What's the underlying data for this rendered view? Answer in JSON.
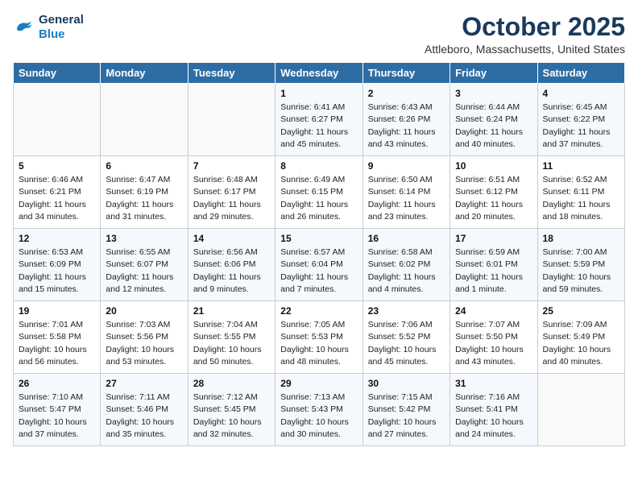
{
  "header": {
    "logo_line1": "General",
    "logo_line2": "Blue",
    "month": "October 2025",
    "location": "Attleboro, Massachusetts, United States"
  },
  "weekdays": [
    "Sunday",
    "Monday",
    "Tuesday",
    "Wednesday",
    "Thursday",
    "Friday",
    "Saturday"
  ],
  "weeks": [
    [
      {
        "day": "",
        "info": ""
      },
      {
        "day": "",
        "info": ""
      },
      {
        "day": "",
        "info": ""
      },
      {
        "day": "1",
        "info": "Sunrise: 6:41 AM\nSunset: 6:27 PM\nDaylight: 11 hours\nand 45 minutes."
      },
      {
        "day": "2",
        "info": "Sunrise: 6:43 AM\nSunset: 6:26 PM\nDaylight: 11 hours\nand 43 minutes."
      },
      {
        "day": "3",
        "info": "Sunrise: 6:44 AM\nSunset: 6:24 PM\nDaylight: 11 hours\nand 40 minutes."
      },
      {
        "day": "4",
        "info": "Sunrise: 6:45 AM\nSunset: 6:22 PM\nDaylight: 11 hours\nand 37 minutes."
      }
    ],
    [
      {
        "day": "5",
        "info": "Sunrise: 6:46 AM\nSunset: 6:21 PM\nDaylight: 11 hours\nand 34 minutes."
      },
      {
        "day": "6",
        "info": "Sunrise: 6:47 AM\nSunset: 6:19 PM\nDaylight: 11 hours\nand 31 minutes."
      },
      {
        "day": "7",
        "info": "Sunrise: 6:48 AM\nSunset: 6:17 PM\nDaylight: 11 hours\nand 29 minutes."
      },
      {
        "day": "8",
        "info": "Sunrise: 6:49 AM\nSunset: 6:15 PM\nDaylight: 11 hours\nand 26 minutes."
      },
      {
        "day": "9",
        "info": "Sunrise: 6:50 AM\nSunset: 6:14 PM\nDaylight: 11 hours\nand 23 minutes."
      },
      {
        "day": "10",
        "info": "Sunrise: 6:51 AM\nSunset: 6:12 PM\nDaylight: 11 hours\nand 20 minutes."
      },
      {
        "day": "11",
        "info": "Sunrise: 6:52 AM\nSunset: 6:11 PM\nDaylight: 11 hours\nand 18 minutes."
      }
    ],
    [
      {
        "day": "12",
        "info": "Sunrise: 6:53 AM\nSunset: 6:09 PM\nDaylight: 11 hours\nand 15 minutes."
      },
      {
        "day": "13",
        "info": "Sunrise: 6:55 AM\nSunset: 6:07 PM\nDaylight: 11 hours\nand 12 minutes."
      },
      {
        "day": "14",
        "info": "Sunrise: 6:56 AM\nSunset: 6:06 PM\nDaylight: 11 hours\nand 9 minutes."
      },
      {
        "day": "15",
        "info": "Sunrise: 6:57 AM\nSunset: 6:04 PM\nDaylight: 11 hours\nand 7 minutes."
      },
      {
        "day": "16",
        "info": "Sunrise: 6:58 AM\nSunset: 6:02 PM\nDaylight: 11 hours\nand 4 minutes."
      },
      {
        "day": "17",
        "info": "Sunrise: 6:59 AM\nSunset: 6:01 PM\nDaylight: 11 hours\nand 1 minute."
      },
      {
        "day": "18",
        "info": "Sunrise: 7:00 AM\nSunset: 5:59 PM\nDaylight: 10 hours\nand 59 minutes."
      }
    ],
    [
      {
        "day": "19",
        "info": "Sunrise: 7:01 AM\nSunset: 5:58 PM\nDaylight: 10 hours\nand 56 minutes."
      },
      {
        "day": "20",
        "info": "Sunrise: 7:03 AM\nSunset: 5:56 PM\nDaylight: 10 hours\nand 53 minutes."
      },
      {
        "day": "21",
        "info": "Sunrise: 7:04 AM\nSunset: 5:55 PM\nDaylight: 10 hours\nand 50 minutes."
      },
      {
        "day": "22",
        "info": "Sunrise: 7:05 AM\nSunset: 5:53 PM\nDaylight: 10 hours\nand 48 minutes."
      },
      {
        "day": "23",
        "info": "Sunrise: 7:06 AM\nSunset: 5:52 PM\nDaylight: 10 hours\nand 45 minutes."
      },
      {
        "day": "24",
        "info": "Sunrise: 7:07 AM\nSunset: 5:50 PM\nDaylight: 10 hours\nand 43 minutes."
      },
      {
        "day": "25",
        "info": "Sunrise: 7:09 AM\nSunset: 5:49 PM\nDaylight: 10 hours\nand 40 minutes."
      }
    ],
    [
      {
        "day": "26",
        "info": "Sunrise: 7:10 AM\nSunset: 5:47 PM\nDaylight: 10 hours\nand 37 minutes."
      },
      {
        "day": "27",
        "info": "Sunrise: 7:11 AM\nSunset: 5:46 PM\nDaylight: 10 hours\nand 35 minutes."
      },
      {
        "day": "28",
        "info": "Sunrise: 7:12 AM\nSunset: 5:45 PM\nDaylight: 10 hours\nand 32 minutes."
      },
      {
        "day": "29",
        "info": "Sunrise: 7:13 AM\nSunset: 5:43 PM\nDaylight: 10 hours\nand 30 minutes."
      },
      {
        "day": "30",
        "info": "Sunrise: 7:15 AM\nSunset: 5:42 PM\nDaylight: 10 hours\nand 27 minutes."
      },
      {
        "day": "31",
        "info": "Sunrise: 7:16 AM\nSunset: 5:41 PM\nDaylight: 10 hours\nand 24 minutes."
      },
      {
        "day": "",
        "info": ""
      }
    ]
  ]
}
